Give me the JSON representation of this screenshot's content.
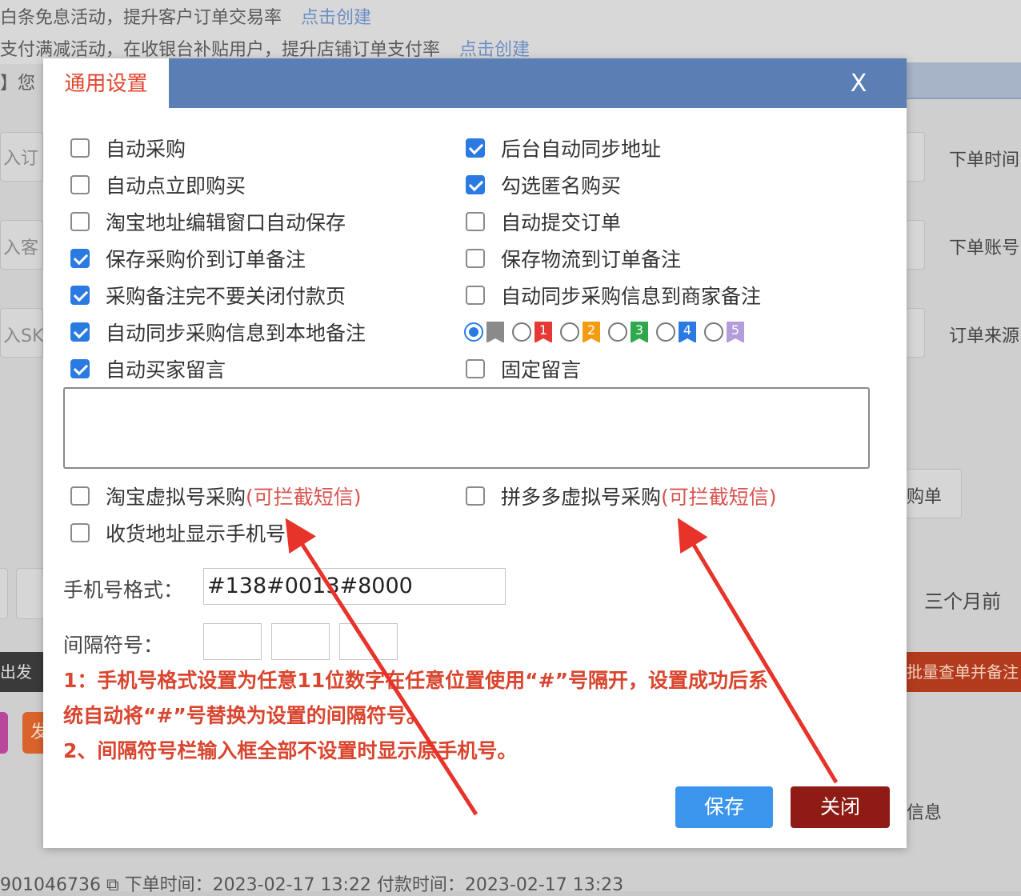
{
  "background": {
    "promo_lines": [
      {
        "text": "白条免息活动，提升客户订单交易率",
        "link": "点击创建"
      },
      {
        "text": "支付满减活动，在收银台补贴用户，提升店铺订单支付率",
        "link": "点击创建"
      }
    ],
    "line3_prefix": "】您",
    "input_hints": [
      "入订",
      "入客",
      "入SK"
    ],
    "right_labels": [
      "下单时间",
      "下单账号",
      "订单来源"
    ],
    "purchase_label": "购单",
    "three_months": "三个月前",
    "dark_left": "出发货",
    "red_right": "批量查单并备注",
    "orange_btn": "发",
    "info_label": "信息",
    "bottom_line": "901046736  ⧉  下单时间：2023-02-17 13:22    付款时间：2023-02-17 13:23"
  },
  "dialog": {
    "title": "通用设置",
    "close_label": "X",
    "options_left": [
      {
        "label": "自动采购",
        "checked": false
      },
      {
        "label": "自动点立即购买",
        "checked": false
      },
      {
        "label": "淘宝地址编辑窗口自动保存",
        "checked": false
      },
      {
        "label": "保存采购价到订单备注",
        "checked": true
      },
      {
        "label": "采购备注完不要关闭付款页",
        "checked": true
      },
      {
        "label": "自动同步采购信息到本地备注",
        "checked": true
      },
      {
        "label": "自动买家留言",
        "checked": true
      }
    ],
    "options_right": [
      {
        "label": "后台自动同步地址",
        "checked": true
      },
      {
        "label": "勾选匿名购买",
        "checked": true
      },
      {
        "label": "自动提交订单",
        "checked": false
      },
      {
        "label": "保存物流到订单备注",
        "checked": false
      },
      {
        "label": "自动同步采购信息到商家备注",
        "checked": false
      },
      {
        "label": "固定留言",
        "checked": false
      }
    ],
    "flags": [
      {
        "num": "",
        "color": "#8a8a8a",
        "selected": true
      },
      {
        "num": "1",
        "color": "#e53935",
        "selected": false
      },
      {
        "num": "2",
        "color": "#f39c12",
        "selected": false
      },
      {
        "num": "3",
        "color": "#2ea84a",
        "selected": false
      },
      {
        "num": "4",
        "color": "#2a7ae2",
        "selected": false
      },
      {
        "num": "5",
        "color": "#b39ddb",
        "selected": false
      }
    ],
    "virtual_taobao": {
      "label": "淘宝虚拟号采购",
      "hint": "(可拦截短信)",
      "checked": false
    },
    "virtual_pdd": {
      "label": "拼多多虚拟号采购",
      "hint": "(可拦截短信)",
      "checked": false
    },
    "show_phone": {
      "label": "收货地址显示手机号",
      "checked": false
    },
    "phone_format_label": "手机号格式：",
    "phone_format_value": "#138#0013#8000",
    "separator_label": "间隔符号：",
    "notes": [
      "1：手机号格式设置为任意11位数字在任意位置使用“#”号隔开，设置成功后系",
      "统自动将“#”号替换为设置的间隔符号。",
      "2、间隔符号栏输入框全部不设置时显示原手机号。"
    ],
    "save_label": "保存",
    "close_button_label": "关闭"
  },
  "colors": {
    "header": "#5a7fb5",
    "accent_red": "#e2452e",
    "save": "#3b95ec",
    "close": "#8e1c15",
    "annotation_arrow": "#e8332a"
  },
  "icons": [
    "close-icon",
    "checkbox-icon",
    "radio-icon",
    "flag-icon",
    "copy-icon",
    "arrow-annotation"
  ]
}
